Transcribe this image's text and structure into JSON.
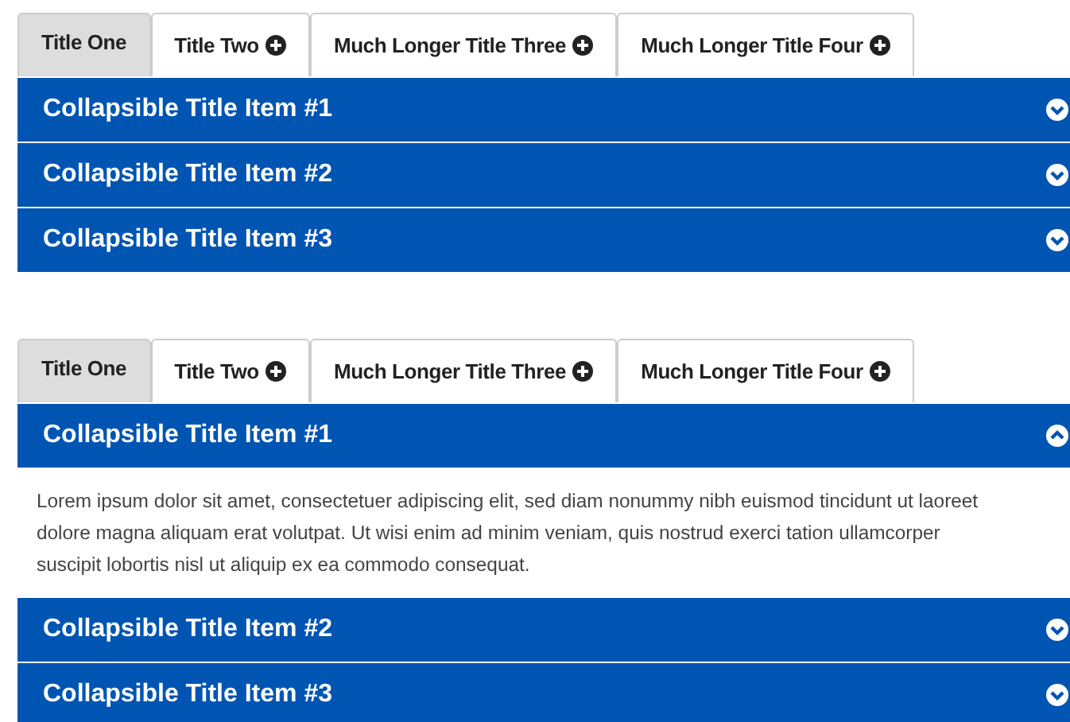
{
  "accordions": [
    {
      "tabs": [
        {
          "label": "Title One",
          "selected": true
        },
        {
          "label": "Title Two",
          "selected": false
        },
        {
          "label": "Much Longer Title Three",
          "selected": false
        },
        {
          "label": "Much Longer Title Four",
          "selected": false
        }
      ],
      "items": [
        {
          "title": "Collapsible Title Item #1",
          "expanded": false
        },
        {
          "title": "Collapsible Title Item #2",
          "expanded": false
        },
        {
          "title": "Collapsible Title Item #3",
          "expanded": false
        }
      ]
    },
    {
      "tabs": [
        {
          "label": "Title One",
          "selected": true
        },
        {
          "label": "Title Two",
          "selected": false
        },
        {
          "label": "Much Longer Title Three",
          "selected": false
        },
        {
          "label": "Much Longer Title Four",
          "selected": false
        }
      ],
      "items": [
        {
          "title": "Collapsible Title Item #1",
          "expanded": true,
          "body": "Lorem ipsum dolor sit amet, consectetuer adipiscing elit, sed diam nonummy nibh euismod tincidunt ut laoreet dolore magna aliquam erat volutpat. Ut wisi enim ad minim veniam, quis nostrud exerci tation ullamcorper suscipit lobortis nisl ut aliquip ex ea commodo consequat."
        },
        {
          "title": "Collapsible Title Item #2",
          "expanded": false
        },
        {
          "title": "Collapsible Title Item #3",
          "expanded": false
        }
      ]
    }
  ]
}
